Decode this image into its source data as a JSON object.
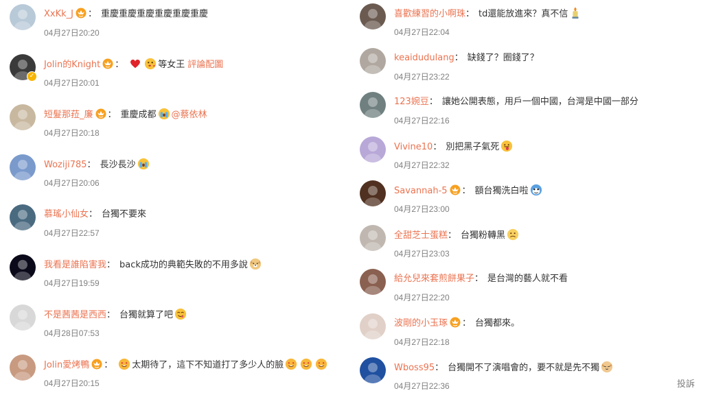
{
  "left_comments": [
    {
      "user": "XxKk_J",
      "text": "重慶重慶重慶重慶重慶重慶",
      "time": "04月27日20:20",
      "avatar_color": "#b8c9d8",
      "badge_emoji": true
    },
    {
      "user": "Jolin的Knight",
      "text": "等女王",
      "time": "04月27日20:01",
      "avatar_color": "#3a3a3a",
      "badge_emoji": true,
      "verified": true,
      "pre_emojis": [
        "heart-emoji",
        "blowkiss-emoji"
      ],
      "suffix_link": "評論配圖"
    },
    {
      "user": "短髮那菈_廉",
      "text": "重慶成都",
      "time": "04月27日20:18",
      "avatar_color": "#c8b8a0",
      "badge_emoji": true,
      "post_emoji": "crying-emoji",
      "mention": "@蔡依林"
    },
    {
      "user": "Woziji785",
      "text": "長沙長沙",
      "time": "04月27日20:06",
      "avatar_color": "#7a9acc",
      "badge_emoji": false,
      "post_emoji": "crying-emoji"
    },
    {
      "user": "慕瑤小仙女",
      "text": "台獨不要來",
      "time": "04月27日22:57",
      "avatar_color": "#4a6a80",
      "badge_emoji": false
    },
    {
      "user": "我看是誰陷害我",
      "text": "back成功的典範失敗的不用多說",
      "time": "04月27日19:59",
      "avatar_color": "#0a0a1a",
      "badge_emoji": false,
      "post_emoji": "doge-emoji"
    },
    {
      "user": "不是茜茜是西西",
      "text": "台獨就算了吧",
      "time": "04月28日07:53",
      "avatar_color": "#d8d8d8",
      "badge_emoji": false,
      "post_emoji": "yum-emoji"
    },
    {
      "user": "Jolin愛烤鴨",
      "text": "太期待了，這下不知道打了多少人的臉",
      "time": "04月27日20:15",
      "avatar_color": "#c89a80",
      "badge_emoji": true,
      "pre_emojis": [
        "hearteyes-emoji"
      ],
      "post_emojis": [
        "hearteyes-emoji",
        "hearteyes-emoji",
        "hearteyes-emoji"
      ]
    }
  ],
  "right_comments": [
    {
      "user": "喜歡練習的小啊珠",
      "text": "td還能放進來？真不信",
      "time": "04月27日22:04",
      "avatar_color": "#6a5a50",
      "badge_emoji": false,
      "post_emoji": "candle-emoji"
    },
    {
      "user": "keaidudulang",
      "text": "缺錢了？圈錢了？",
      "time": "04月27日23:22",
      "avatar_color": "#b0a8a0",
      "badge_emoji": false
    },
    {
      "user": "123婉豆",
      "text": "讓她公開表態，用戶一個中國，台灣是中國一部分",
      "time": "04月27日22:16",
      "avatar_color": "#708080",
      "badge_emoji": false
    },
    {
      "user": "Vivine10",
      "text": "別把黑子氣死",
      "time": "04月27日22:32",
      "avatar_color": "#b8a8d8",
      "badge_emoji": false,
      "post_emoji": "tongue-emoji"
    },
    {
      "user": "Savannah-5",
      "text": "額台獨洗白啦",
      "time": "04月27日23:00",
      "avatar_color": "#503020",
      "badge_emoji": true,
      "post_emoji": "blue-emoji"
    },
    {
      "user": "全甜芝士蛋糕",
      "text": "台獨粉轉黑",
      "time": "04月27日23:03",
      "avatar_color": "#c0b8b0",
      "badge_emoji": false,
      "post_emoji": "sad-emoji"
    },
    {
      "user": "給允兒來套煎餅果子",
      "text": "是台灣的藝人就不看",
      "time": "04月27日22:20",
      "avatar_color": "#8a6050",
      "badge_emoji": false
    },
    {
      "user": "波剛的小玉琢",
      "text": "台獨都來。",
      "time": "04月27日22:18",
      "avatar_color": "#e0d0c8",
      "badge_emoji": true
    },
    {
      "user": "Wboss95",
      "text": "台獨開不了演唱會的，要不就是先不獨",
      "time": "04月27日22:36",
      "avatar_color": "#2050a0",
      "badge_emoji": false,
      "post_emoji": "cat-emoji"
    }
  ],
  "report_label": "投訴"
}
